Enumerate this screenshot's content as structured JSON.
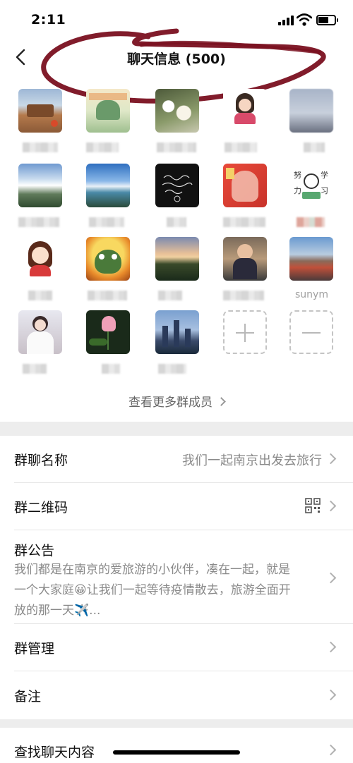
{
  "status_bar": {
    "time": "2:11"
  },
  "nav": {
    "title": "聊天信息 (500)"
  },
  "members": [
    {
      "id": "m1",
      "avatar": "photo-landscape-gate"
    },
    {
      "id": "m2",
      "avatar": "illustration-green"
    },
    {
      "id": "m3",
      "avatar": "flowers-white"
    },
    {
      "id": "m4",
      "avatar": "cartoon-girl-sticker"
    },
    {
      "id": "m5",
      "avatar": "photo-sky-blur"
    },
    {
      "id": "m6",
      "avatar": "photo-mountains-clouds"
    },
    {
      "id": "m7",
      "avatar": "photo-lake-sky"
    },
    {
      "id": "m8",
      "avatar": "dark-handwriting"
    },
    {
      "id": "m9",
      "avatar": "red-portrait"
    },
    {
      "id": "m10",
      "avatar": "study-sticker"
    },
    {
      "id": "m11",
      "avatar": "cartoon-girl-red"
    },
    {
      "id": "m12",
      "avatar": "cartoon-frog"
    },
    {
      "id": "m13",
      "avatar": "photo-sunset-park"
    },
    {
      "id": "m14",
      "avatar": "photo-person"
    },
    {
      "id": "m15",
      "avatar": "photo-group",
      "name": "sunym"
    },
    {
      "id": "m16",
      "avatar": "photo-girl-white"
    },
    {
      "id": "m17",
      "avatar": "lotus-flower"
    },
    {
      "id": "m18",
      "avatar": "city-skyline"
    }
  ],
  "more_members": "查看更多群成员",
  "settings": {
    "group_name_label": "群聊名称",
    "group_name_value": "我们一起南京出发去旅行",
    "qr_label": "群二维码",
    "notice_label": "群公告",
    "notice_line1": "我们都是在南京的爱旅游的小伙伴，凑在一起，就是",
    "notice_line2": "一个大家庭😀让我们一起等待疫情散去，旅游全面开",
    "notice_line3": "放的那一天✈️...",
    "manage_label": "群管理",
    "remark_label": "备注",
    "search_label": "查找聊天内容"
  },
  "colors": {
    "accent_scribble": "#7a1020",
    "bg_grey": "#ededed"
  }
}
